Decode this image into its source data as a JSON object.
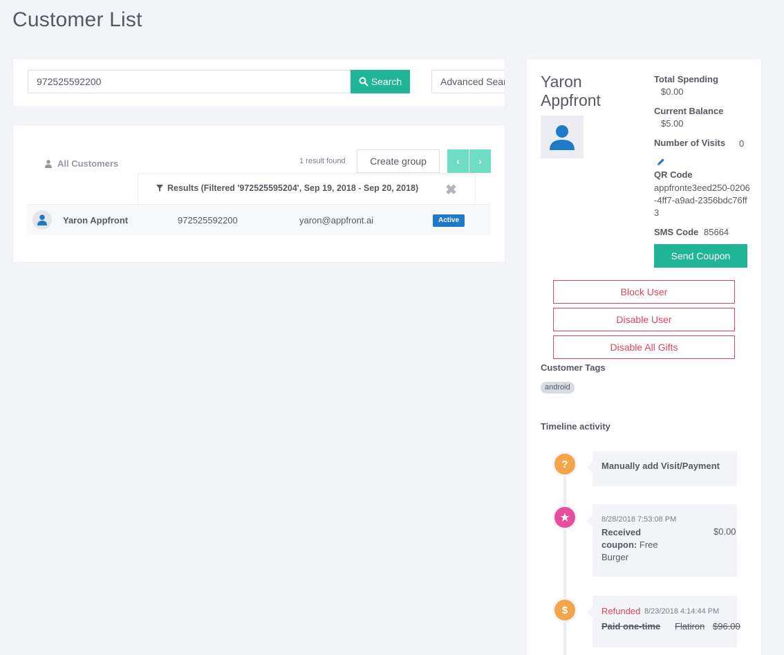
{
  "page": {
    "title": "Customer List"
  },
  "search": {
    "value": "972525592200",
    "button_label": "Search",
    "advanced_label": "Advanced Search"
  },
  "list": {
    "all_customers_label": "All Customers",
    "result_count": "1 result found",
    "create_group_label": "Create group",
    "prev_label": "‹",
    "next_label": "›",
    "filter_label": "Results (Filtered '972525595204', Sep 19, 2018 - Sep 20, 2018)",
    "close_label": "✖",
    "rows": [
      {
        "name": "Yaron Appfront",
        "phone": "972525592200",
        "email": "yaron@appfront.ai",
        "status": "Active"
      }
    ]
  },
  "detail": {
    "name": "Yaron Appfront",
    "total_spending_label": "Total Spending",
    "total_spending": "$0.00",
    "current_balance_label": "Current Balance",
    "current_balance": "$5.00",
    "visits_label": "Number of Visits",
    "visits": "0",
    "qr_label": "QR Code",
    "qr_value": "appfronte3eed250-0206-4ff7-a9ad-2356bdc76ff3",
    "sms_label": "SMS Code",
    "sms_value": "85664",
    "send_coupon_label": "Send Coupon",
    "block_user_label": "Block User",
    "disable_user_label": "Disable User",
    "disable_gifts_label": "Disable All Gifts",
    "tags_label": "Customer Tags",
    "tags": [
      "android"
    ],
    "timeline_label": "Timeline activity",
    "timeline": [
      {
        "icon": "question-icon",
        "glyph": "?",
        "title": "Manually add Visit/Payment"
      },
      {
        "icon": "star-icon",
        "glyph": "★",
        "time": "8/28/2018 7:53:08 PM",
        "desc_bold": "Received coupon:",
        "desc": " Free Burger",
        "amount": "$0.00"
      },
      {
        "icon": "dollar-icon",
        "glyph": "$",
        "status": "Refunded",
        "time": "8/23/2018 4:14:44 PM",
        "type": "Paid one-time",
        "location": "Flatiron",
        "amount": "$96.00"
      }
    ]
  },
  "colors": {
    "accent": "#1fb596",
    "accent_light": "#6fdcc4",
    "danger": "#e0445a",
    "status_active": "#1e7ac9",
    "avatar_blue": "#1e7ac9",
    "timeline_orange": "#f2a54a",
    "timeline_pink": "#e84d9c"
  }
}
